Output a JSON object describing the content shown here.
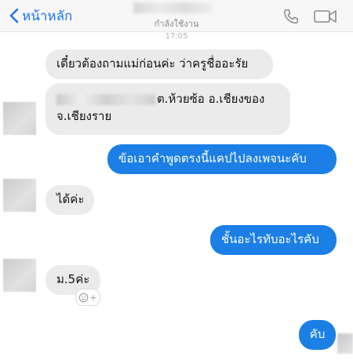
{
  "header": {
    "back_label": "หน้าหลัก",
    "status": "กำลังใช้งาน",
    "time": "17:05"
  },
  "messages": [
    {
      "side": "in",
      "text": "เดี๋ยวต้องถามแม่ก่อนค่ะ ว่าครูชื่ออะรัย"
    },
    {
      "side": "in",
      "line1": "ต.ห้วยซ้อ อ.เชียงของ",
      "line2": "จ.เชียงราย"
    },
    {
      "side": "out",
      "text": "ข้อเอาคำพูดตรงนี้แคปไปลงเพจนะคับ"
    },
    {
      "side": "in",
      "text": "ได้ค่ะ"
    },
    {
      "side": "out",
      "text": "ชั้นอะไรทับอะไรคับ"
    },
    {
      "side": "in",
      "text": "ม.5ค่ะ"
    },
    {
      "side": "out",
      "text": "คับ"
    }
  ],
  "reaction": {
    "icon": "smiley-add-icon",
    "symbol": "+"
  },
  "colors": {
    "accent": "#1b7fe5",
    "incoming": "#ebebeb",
    "link": "#1a73e8"
  }
}
